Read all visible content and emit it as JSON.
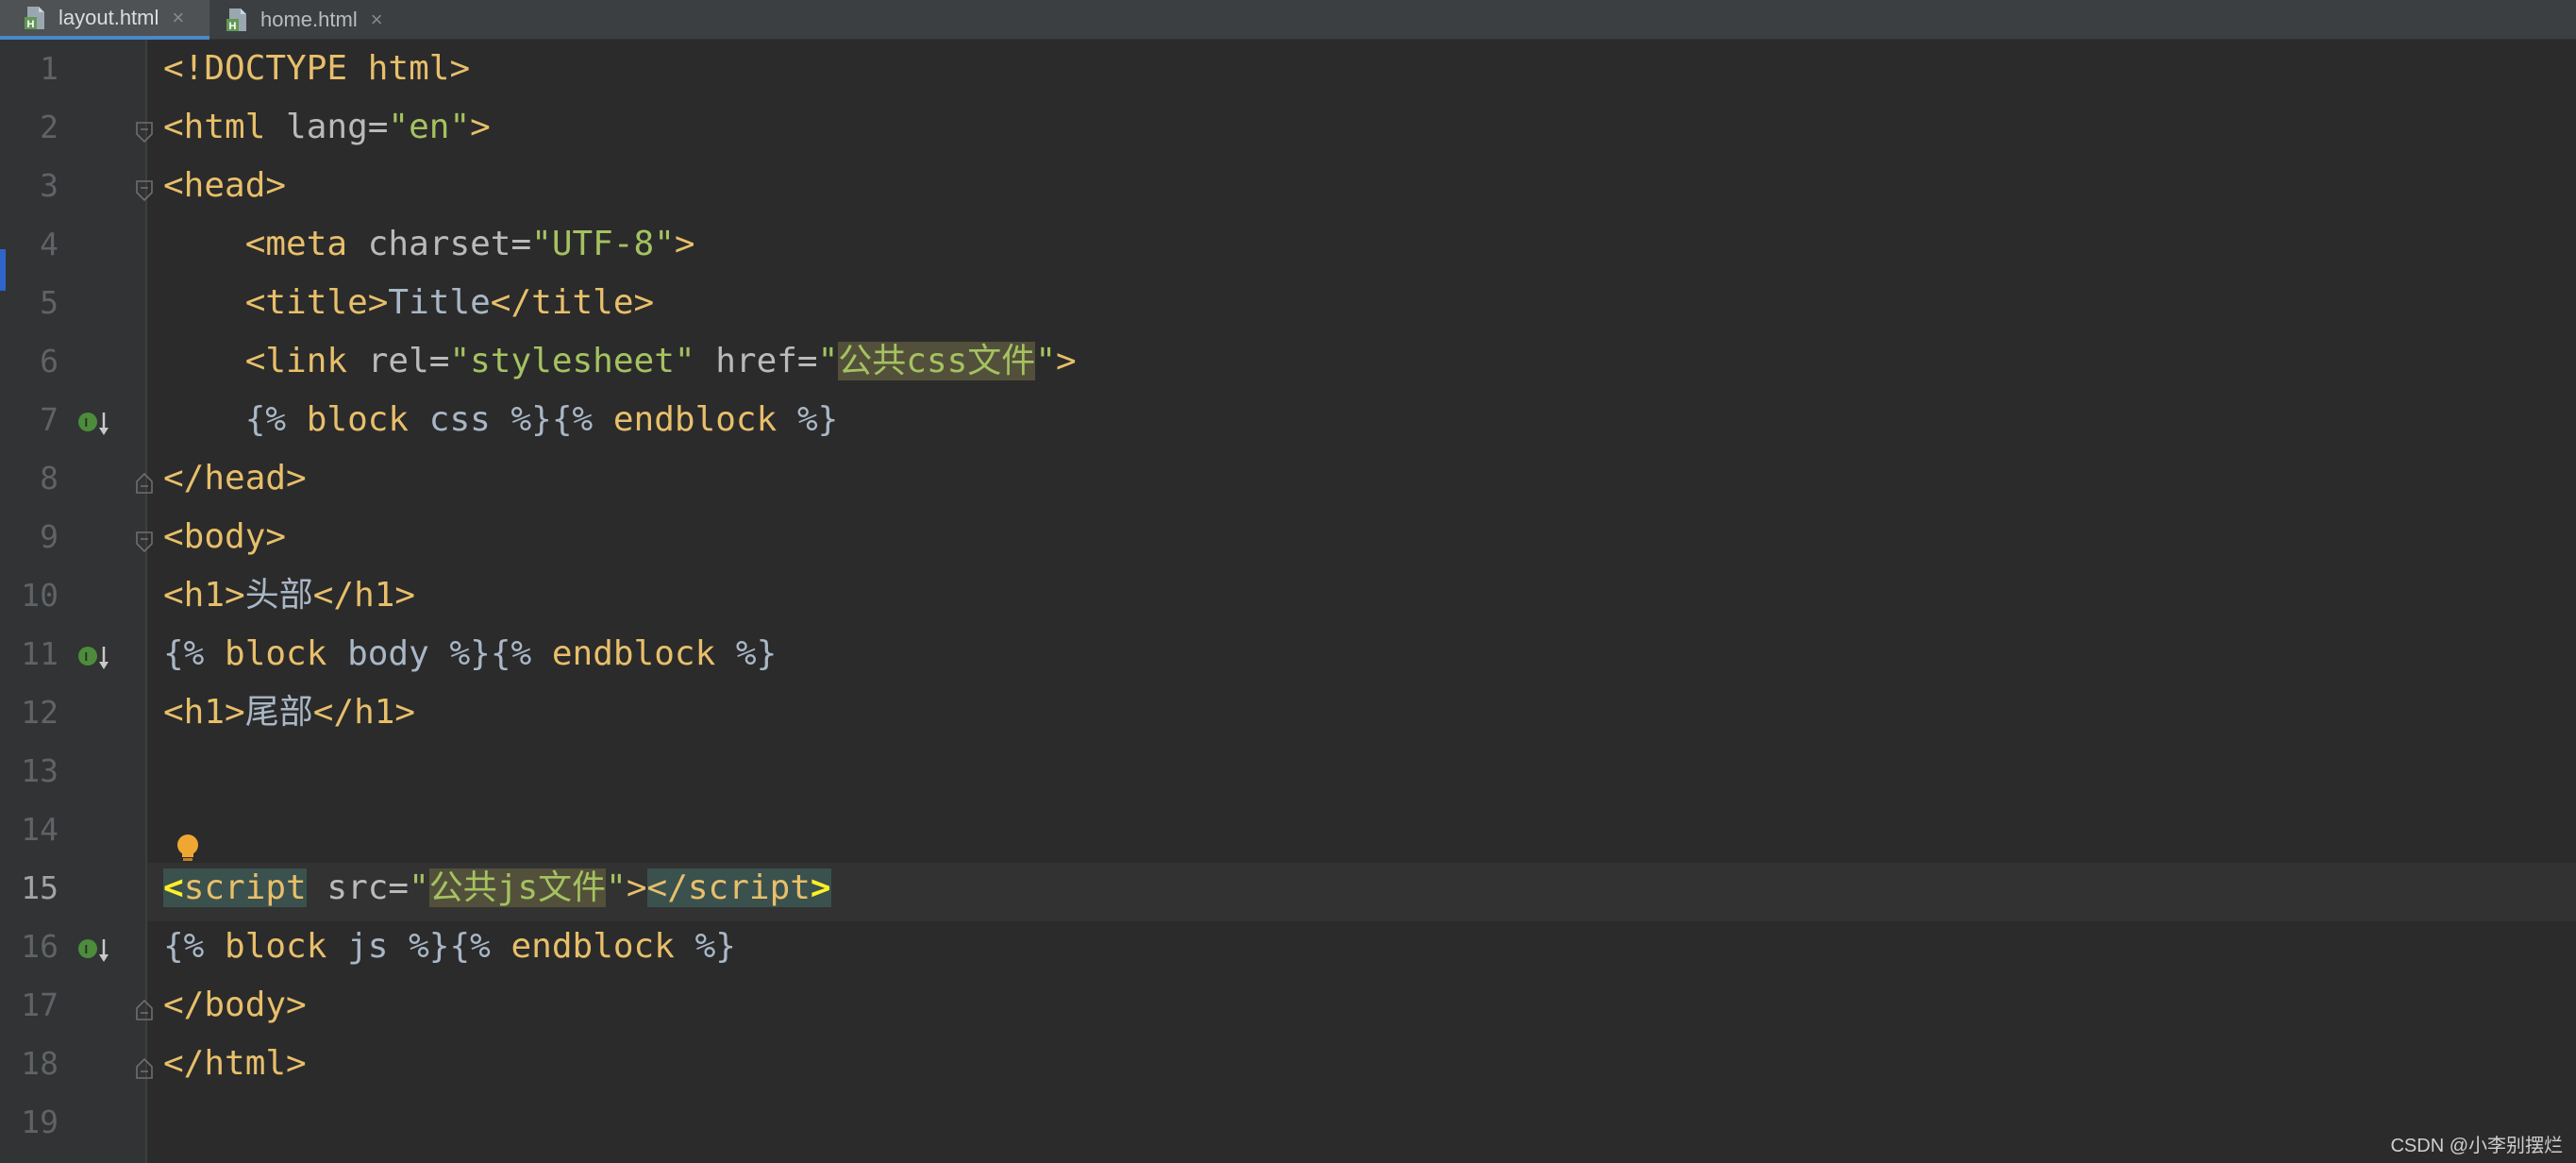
{
  "tabs": [
    {
      "label": "layout.html",
      "active": true,
      "close": "×"
    },
    {
      "label": "home.html",
      "active": false,
      "close": "×"
    }
  ],
  "editor": {
    "current_line": 15,
    "lines": [
      {
        "num": "1"
      },
      {
        "num": "2"
      },
      {
        "num": "3"
      },
      {
        "num": "4"
      },
      {
        "num": "5"
      },
      {
        "num": "6"
      },
      {
        "num": "7"
      },
      {
        "num": "8"
      },
      {
        "num": "9"
      },
      {
        "num": "10"
      },
      {
        "num": "11"
      },
      {
        "num": "12"
      },
      {
        "num": "13"
      },
      {
        "num": "14"
      },
      {
        "num": "15"
      },
      {
        "num": "16"
      },
      {
        "num": "17"
      },
      {
        "num": "18"
      },
      {
        "num": "19"
      }
    ]
  },
  "code": {
    "l1": {
      "doctype": "<!DOCTYPE",
      "doctype_rest": " html>"
    },
    "l2": {
      "open": "<html",
      "attr": " lang=",
      "val": "\"en\"",
      "close": ">"
    },
    "l3": {
      "tag": "<head>"
    },
    "l4": {
      "indent": "    ",
      "open": "<meta",
      "attr": " charset=",
      "val": "\"UTF-8\"",
      "close": ">"
    },
    "l5": {
      "indent": "    ",
      "open": "<title>",
      "text": "Title",
      "close": "</title>"
    },
    "l6": {
      "indent": "    ",
      "open": "<link",
      "attr1": " rel=",
      "val1": "\"stylesheet\"",
      "attr2": " href=",
      "q1": "\"",
      "val2": "公共css文件",
      "q2": "\"",
      "close": ">"
    },
    "l7": {
      "indent": "    ",
      "a": "{%",
      "b": " block",
      "c": " css",
      "d": " %}",
      "e": "{%",
      "f": " endblock",
      "g": " %}"
    },
    "l8": {
      "tag": "</head>"
    },
    "l9": {
      "tag": "<body>"
    },
    "l10": {
      "open": "<h1>",
      "text": "头部",
      "close": "</h1>"
    },
    "l11": {
      "a": "{%",
      "b": " block",
      "c": " body",
      "d": " %}",
      "e": "{%",
      "f": " endblock",
      "g": " %}"
    },
    "l12": {
      "open": "<h1>",
      "text": "尾部",
      "close": "</h1>"
    },
    "l15": {
      "lt": "<",
      "open": "script",
      "attr": " src=",
      "q1": "\"",
      "val": "公共js文件",
      "q2": "\"",
      "gt": ">",
      "close_lt": "</script",
      "close_gt": ">"
    },
    "l16": {
      "a": "{%",
      "b": " block",
      "c": " js",
      "d": " %}",
      "e": "{%",
      "f": " endblock",
      "g": " %}"
    },
    "l17": {
      "tag": "</body>"
    },
    "l18": {
      "tag": "</html>"
    }
  },
  "watermark": "CSDN @小李别摆烂",
  "colors": {
    "background": "#2b2b2b",
    "gutter": "#313335",
    "tag": "#e8bf6a",
    "attribute": "#bababa",
    "string": "#a5c261",
    "text": "#a9b7c6",
    "line_number": "#606366",
    "active_tab_underline": "#4a88c7"
  },
  "icons": {
    "tab_file": "html-file-icon",
    "fold": "fold-marker-icon",
    "implemented": "implemented-block-icon",
    "intention": "lightbulb-icon"
  }
}
